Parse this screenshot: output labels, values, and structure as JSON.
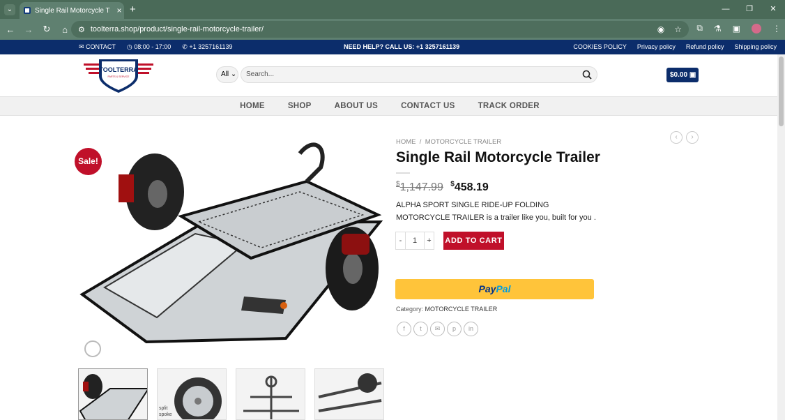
{
  "browser": {
    "tab_title": "Single Rail Motorcycle Trailer –",
    "url": "toolterra.shop/product/single-rail-motorcycle-trailer/"
  },
  "topbar": {
    "contact": "CONTACT",
    "hours": "08:00 - 17:00",
    "phone": "+1 3257161139",
    "help": "NEED HELP? CALL US: +1 3257161139",
    "links": [
      "COOKIES POLICY",
      "Privacy policy",
      "Refund policy",
      "Shipping policy"
    ]
  },
  "logo": {
    "text": "TOOLTERRA",
    "sub": "PARTS & SERVICE"
  },
  "search": {
    "category": "All",
    "placeholder": "Search..."
  },
  "cart": {
    "total": "$0.00"
  },
  "nav": [
    "HOME",
    "SHOP",
    "ABOUT US",
    "CONTACT US",
    "TRACK ORDER"
  ],
  "product": {
    "sale_badge": "Sale!",
    "breadcrumb": [
      "HOME",
      "MOTORCYCLE TRAILER"
    ],
    "title": "Single Rail Motorcycle Trailer",
    "old_price_symbol": "$",
    "old_price": "1,147.99",
    "price_symbol": "$",
    "price": "458.19",
    "description": "ALPHA SPORT SINGLE RIDE-UP FOLDING MOTORCYCLE TRAILER is a trailer like you, built for you .",
    "quantity": "1",
    "add_to_cart": "ADD TO CART",
    "paypal_a": "Pay",
    "paypal_b": "Pal",
    "category_label": "Category:",
    "category": "MOTORCYCLE TRAILER",
    "thumb_text": "split spoke"
  },
  "colors": {
    "brand_navy": "#0c2d6b",
    "brand_red": "#c0102a",
    "paypal_yellow": "#ffc43a"
  }
}
